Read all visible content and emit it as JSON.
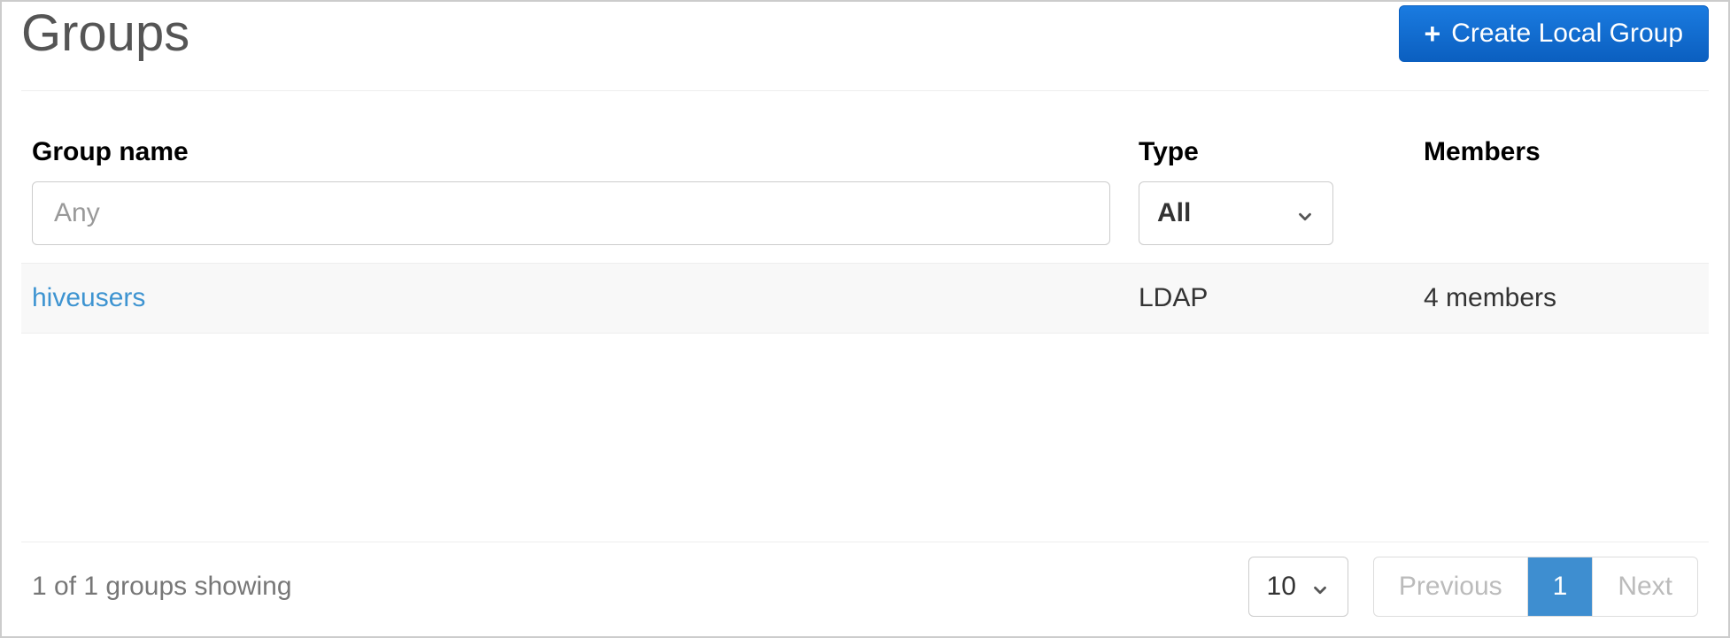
{
  "header": {
    "title": "Groups",
    "create_button_label": "Create Local Group"
  },
  "columns": {
    "name_label": "Group name",
    "type_label": "Type",
    "members_label": "Members"
  },
  "filters": {
    "name_placeholder": "Any",
    "type_selected": "All"
  },
  "rows": [
    {
      "name": "hiveusers",
      "type": "LDAP",
      "members": "4 members"
    }
  ],
  "footer": {
    "status": "1 of 1 groups showing",
    "page_size": "10",
    "prev_label": "Previous",
    "next_label": "Next",
    "current_page": "1"
  }
}
